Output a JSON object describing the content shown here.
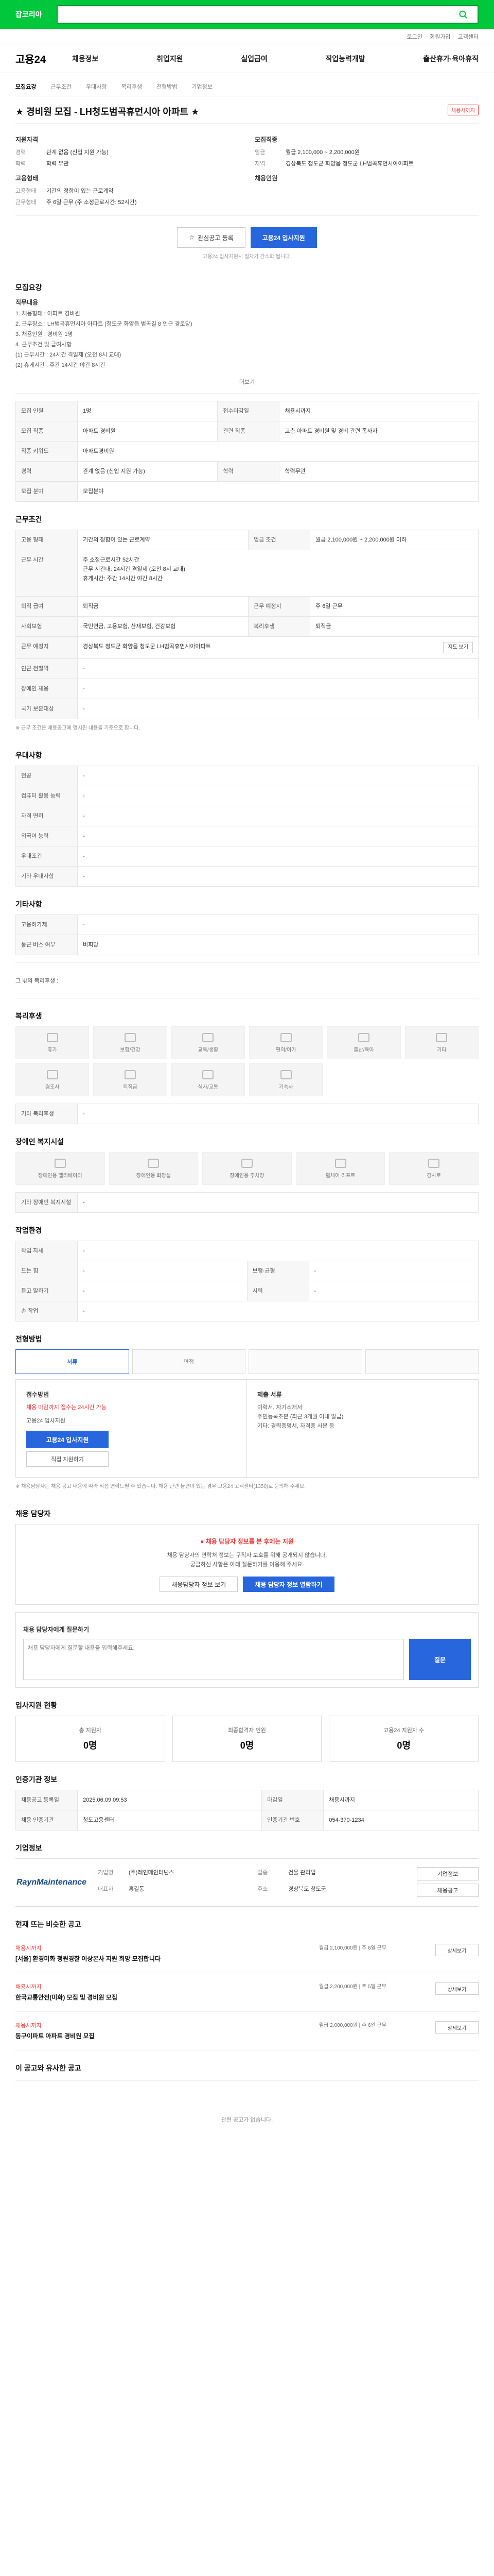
{
  "topbar": {
    "logo": "잡코리아",
    "search_placeholder": "",
    "search_value": ""
  },
  "util": [
    "로그인",
    "회원가입",
    "고객센터"
  ],
  "gnb": {
    "brand": "고용24",
    "menu": [
      "채용정보",
      "취업지원",
      "실업급여",
      "직업능력개발",
      "출산휴가·육아휴직"
    ]
  },
  "crumbs": [
    "모집요강",
    "근무조건",
    "우대사항",
    "복리후생",
    "전형방법",
    "기업정보"
  ],
  "job": {
    "title": "★ 경비원 모집 - LH청도범곡휴먼시아 아파트 ★",
    "badge": "채용시까지",
    "left_title": "지원자격",
    "left": [
      {
        "k": "경력",
        "v": "관계 없음 (신입 지원 가능)"
      },
      {
        "k": "학력",
        "v": "학력 무관"
      }
    ],
    "left_title2": "고용형태",
    "left2": [
      {
        "k": "고용형태",
        "v": "기간의 정함이 있는 근로계약"
      },
      {
        "k": "근무형태",
        "v": "주 6일 근무 (주 소정근로시간: 52시간)"
      }
    ],
    "right_title": "모집직종",
    "right": [
      {
        "k": "임금",
        "v": "월급 2,100,000 ~ 2,200,000원"
      },
      {
        "k": "지역",
        "v": "경상북도 청도군 화양읍 청도군 LH범곡휴먼시아아파트"
      }
    ],
    "right_title2": "채용인원",
    "btn_scrap": "관심공고 등록",
    "btn_apply": "고용24 입사지원",
    "note": "고용24 입사지원시 절차가 간소화 됩니다."
  },
  "recruit": {
    "title": "모집요강",
    "sub": "직무내용",
    "lines": [
      "1. 채용형태 : 아파트 경비원",
      "2. 근무장소 : LH범곡휴먼시아 아파트 (청도군 화양읍 범곡길 8 인근 경로당)",
      "3. 채용인원 : 경비원 1명",
      "4. 근무조건 및 급여사항",
      "(1) 근무시간 : 24시간 격일제 (오전 8시 교대)",
      "(2) 휴게시간 : 주간 14시간 야간 8시간"
    ],
    "more": "더보기",
    "table": [
      [
        "모집 인원",
        "1명",
        "접수마감일",
        "채용시까지"
      ],
      [
        "모집 직종",
        "아파트 경비원",
        "관련 직종",
        "고층 아파트 경비원 및 경비 관련 종사자"
      ],
      [
        "직종 키워드",
        "아파트경비원",
        "",
        ""
      ],
      [
        "경력",
        "관계 없음 (신입 지원 가능)",
        "학력",
        "학력무관"
      ],
      [
        "모집 분야",
        "모집분야",
        "",
        ""
      ]
    ]
  },
  "cond": {
    "title": "근무조건",
    "table": [
      [
        "고용 형태",
        "기간의 정함이 있는 근로계약",
        "임금 조건",
        "월급 2,100,000원 ~ 2,200,000원 이하"
      ],
      [
        "근무 시간",
        "주 소정근로시간 52시간\n근무 시간대: 24시간 격일제 (오전 8시 교대)\n휴게시간: 주간 14시간 야간 8시간",
        "",
        ""
      ],
      [
        "퇴직 급여",
        "퇴직금",
        "근무 예정지",
        "주 6일 근무"
      ],
      [
        "사회보험",
        "국민연금, 고용보험, 산재보험, 건강보험",
        "복리후생",
        "퇴직금"
      ],
      [
        "근무 예정지",
        "경상북도 청도군 화양읍 청도군 LH범곡휴먼시아아파트",
        "",
        ""
      ],
      [
        "인근 전철역",
        "-",
        "",
        ""
      ],
      [
        "장애인 채용",
        "-",
        "",
        ""
      ],
      [
        "국가 보훈대상",
        "-",
        "",
        ""
      ]
    ],
    "map_btn": "지도 보기",
    "foot": "※ 근무 조건은 채용공고에 명시된 내용을 기준으로 합니다."
  },
  "pref": {
    "title": "우대사항",
    "table": [
      [
        "전공",
        "-"
      ],
      [
        "컴퓨터 활용 능력",
        "-"
      ],
      [
        "자격 면허",
        "-"
      ],
      [
        "외국어 능력",
        "-"
      ],
      [
        "우대조건",
        "-"
      ],
      [
        "기타 우대사항",
        "-"
      ]
    ]
  },
  "etc": {
    "title": "기타사항",
    "table": [
      [
        "고용허가제",
        "-"
      ],
      [
        "통근 버스 여부",
        "비희망"
      ]
    ],
    "lines": [
      "그 밖의 복리후생 :"
    ]
  },
  "welfare": {
    "title": "복리후생",
    "icons": [
      "휴가",
      "보험/건강",
      "교육/생활",
      "편의/여가",
      "출산/육아",
      "기타",
      "경조사",
      "퇴직금",
      "식사/교통",
      "기숙사",
      "",
      ""
    ],
    "etc_label": "기타 복리후생",
    "etc_value": "-"
  },
  "disabled": {
    "title": "장애인 복지시설",
    "icons": [
      "장애인용 엘리베이터",
      "장애인용 화장실",
      "장애인용 주차장",
      "휠체어 리프트",
      "경사로"
    ],
    "etc_label": "기타 장애인 복지시설",
    "etc_value": "-"
  },
  "work": {
    "title": "작업환경",
    "table": [
      [
        "작업 자세",
        "-",
        "",
        ""
      ],
      [
        "드는 힘",
        "-",
        "보행·균형",
        "-"
      ],
      [
        "듣고 말하기",
        "-",
        "시력",
        "-"
      ],
      [
        "손 작업",
        "-",
        "",
        ""
      ]
    ]
  },
  "process": {
    "title": "전형방법",
    "steps": [
      "서류",
      "면접",
      "",
      ""
    ],
    "apply_title": "접수방법",
    "apply_red": "채용 마감까지 접수는 24시간 가능",
    "apply_method": "고용24 입사지원",
    "apply_btn": "고용24 입사지원",
    "apply_ghost": "직접 지원하기",
    "doc_title": "제출 서류",
    "doc_lines": [
      "이력서, 자기소개서",
      "주민등록초본 (최근 3개월 이내 발급)",
      "기타: 경력증명서, 자격증 사본 등"
    ],
    "fine": "※ 채용담당자는 채용 공고 내용에 따라 직접 연락드릴 수 있습니다. 채용 관련 불편이 있는 경우 고용24 고객센터(1350)로 문의해 주세요."
  },
  "manager": {
    "title": "채용 담당자",
    "warn": "채용 담당자 정보를 본 후에는 지원",
    "p1": "채용 담당자의 연락처 정보는 구직자 보호를 위해 공개되지 않습니다.",
    "p2": "궁금하신 사항은 아래 질문하기를 이용해 주세요.",
    "btn_a": "채용담당자 정보 보기",
    "btn_b": "채용 담당자 정보 열람하기",
    "qa_title": "채용 담당자에게 질문하기",
    "qa_placeholder": "채용 담당자에게 질문할 내용을 입력해주세요.",
    "qa_send": "질문"
  },
  "stats": {
    "title": "입사지원 현황",
    "items": [
      {
        "t": "총 지원자",
        "n": "0명"
      },
      {
        "t": "최종합격자 인원",
        "n": "0명"
      },
      {
        "t": "고용24 지원자 수",
        "n": "0명"
      }
    ]
  },
  "info": {
    "title": "인증기관 정보",
    "table": [
      [
        "채용공고 등록일",
        "2025.06.09 09:53",
        "마감일",
        "채용시까지"
      ],
      [
        "채용 인증기관",
        "청도고용센터",
        "인증기관 번호",
        "054-370-1234"
      ]
    ]
  },
  "company": {
    "title": "기업정보",
    "logo": "RaynMaintenance",
    "info": [
      [
        "기업명",
        "(주)레인메인터넌스"
      ],
      [
        "업종",
        "건물 관리업"
      ],
      [
        "대표자",
        "홍길동"
      ],
      [
        "주소",
        "경상북도 청도군"
      ]
    ],
    "btn_a": "기업정보",
    "btn_b": "채용공고"
  },
  "recs": {
    "title": "현재 뜨는 비슷한 공고",
    "items": [
      {
        "co": "채용시까지",
        "tt": "[서울] 환경미화 청원경찰 이상본사 지원 희망 모집합니다",
        "m": "월급 2,100,000원 | 주 6일 근무"
      },
      {
        "co": "채용시까지",
        "tt": "한국교통안전(미화) 모집 및 경비원 모집",
        "m": "월급 2,200,000원 | 주 5일 근무"
      },
      {
        "co": "채용시까지",
        "tt": "동구이파트 아파트 경비원 모집",
        "m": "월급 2,000,000원 | 주 6일 근무"
      }
    ],
    "btn": "상세보기"
  },
  "foot": {
    "title": "이 공고와 유사한 공고",
    "empty": "관련 공고가 없습니다."
  }
}
